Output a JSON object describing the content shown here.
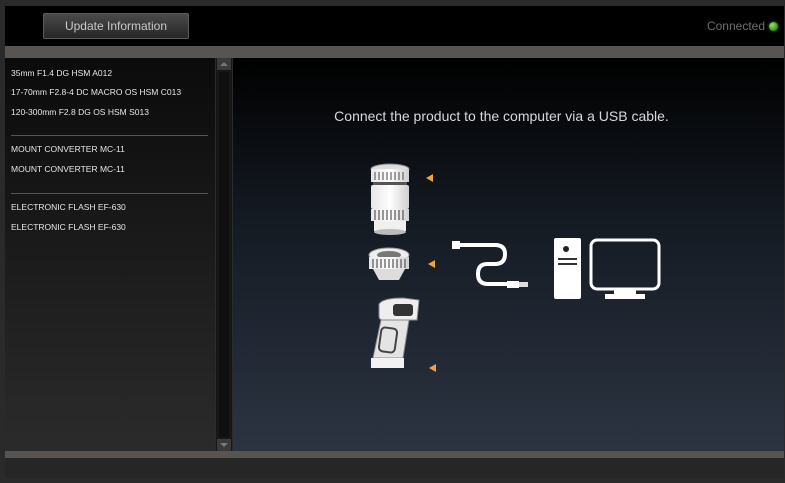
{
  "header": {
    "update_button_label": "Update Information",
    "status_text": "Connected",
    "status_color": "#3a8a1e"
  },
  "sidebar": {
    "groups": [
      {
        "items": [
          "35mm F1.4 DG HSM A012",
          "17-70mm F2.8-4 DC MACRO OS HSM C013",
          "120-300mm F2.8 DG OS HSM S013"
        ]
      },
      {
        "items": [
          "MOUNT CONVERTER MC-11",
          "MOUNT CONVERTER MC-11"
        ]
      },
      {
        "items": [
          "ELECTRONIC FLASH EF-630",
          "ELECTRONIC FLASH EF-630"
        ]
      }
    ]
  },
  "main": {
    "message": "Connect the product to the computer via a USB cable.",
    "illustration": {
      "icons": [
        "lens-icon",
        "mount-converter-icon",
        "flash-icon",
        "usb-cable-icon",
        "computer-icon",
        "monitor-icon"
      ],
      "arrow_color": "#f0a23c"
    }
  }
}
